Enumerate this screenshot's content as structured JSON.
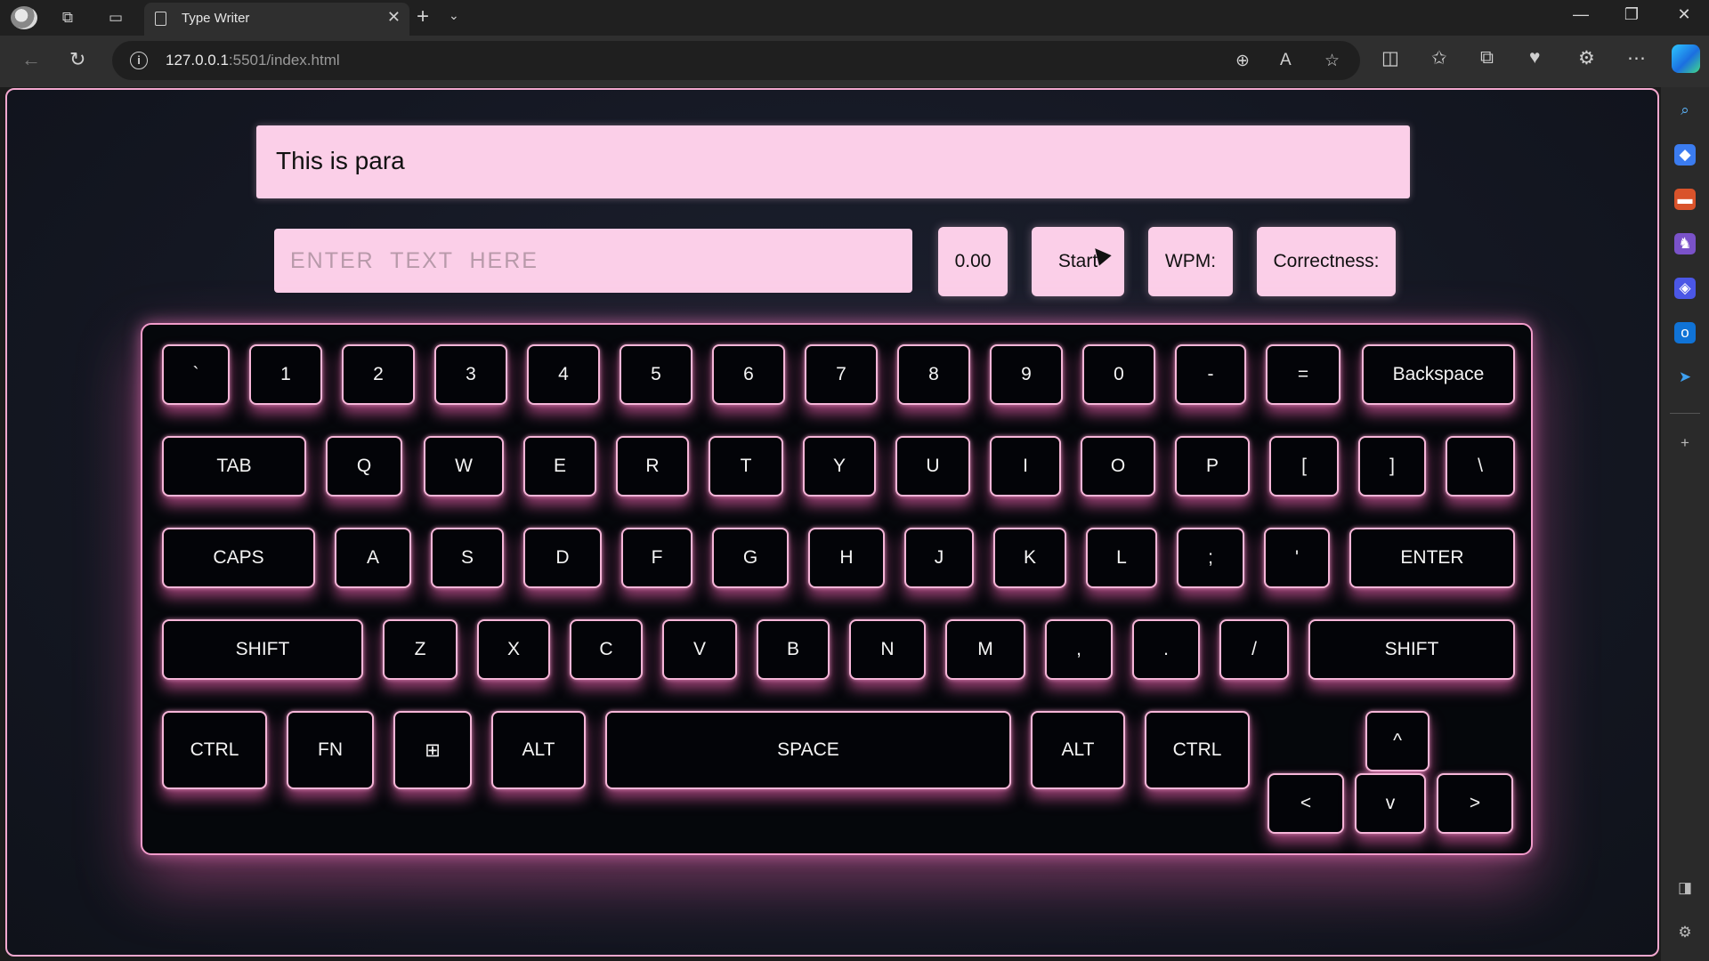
{
  "browser": {
    "tab_title": "Type Writer",
    "url_host": "127.0.0.1",
    "url_rest": ":5501/index.html"
  },
  "app": {
    "paragraph": "This is para",
    "input_placeholder": "ENTER  TEXT  HERE",
    "timer": "0.00",
    "start_label": "Start",
    "wpm_label": "WPM:",
    "correctness_label": "Correctness:"
  },
  "keyboard": {
    "row1": [
      "`",
      "1",
      "2",
      "3",
      "4",
      "5",
      "6",
      "7",
      "8",
      "9",
      "0",
      "-",
      "=",
      "Backspace"
    ],
    "row2": [
      "TAB",
      "Q",
      "W",
      "E",
      "R",
      "T",
      "Y",
      "U",
      "I",
      "O",
      "P",
      "[",
      "]",
      "\\"
    ],
    "row3": [
      "CAPS",
      "A",
      "S",
      "D",
      "F",
      "G",
      "H",
      "J",
      "K",
      "L",
      ";",
      "'",
      "ENTER"
    ],
    "row4": [
      "SHIFT",
      "Z",
      "X",
      "C",
      "V",
      "B",
      "N",
      "M",
      ",",
      ".",
      "/",
      "SHIFT"
    ],
    "row5": [
      "CTRL",
      "FN",
      "⊞",
      "ALT",
      "SPACE",
      "ALT",
      "CTRL"
    ],
    "arrows": [
      "^",
      "<",
      "v",
      ">"
    ]
  },
  "colors": {
    "accent_pink": "#fbcfe8",
    "key_border": "#f6b6d8",
    "glow": "#e860aa",
    "keyboard_bg": "#05070b"
  }
}
